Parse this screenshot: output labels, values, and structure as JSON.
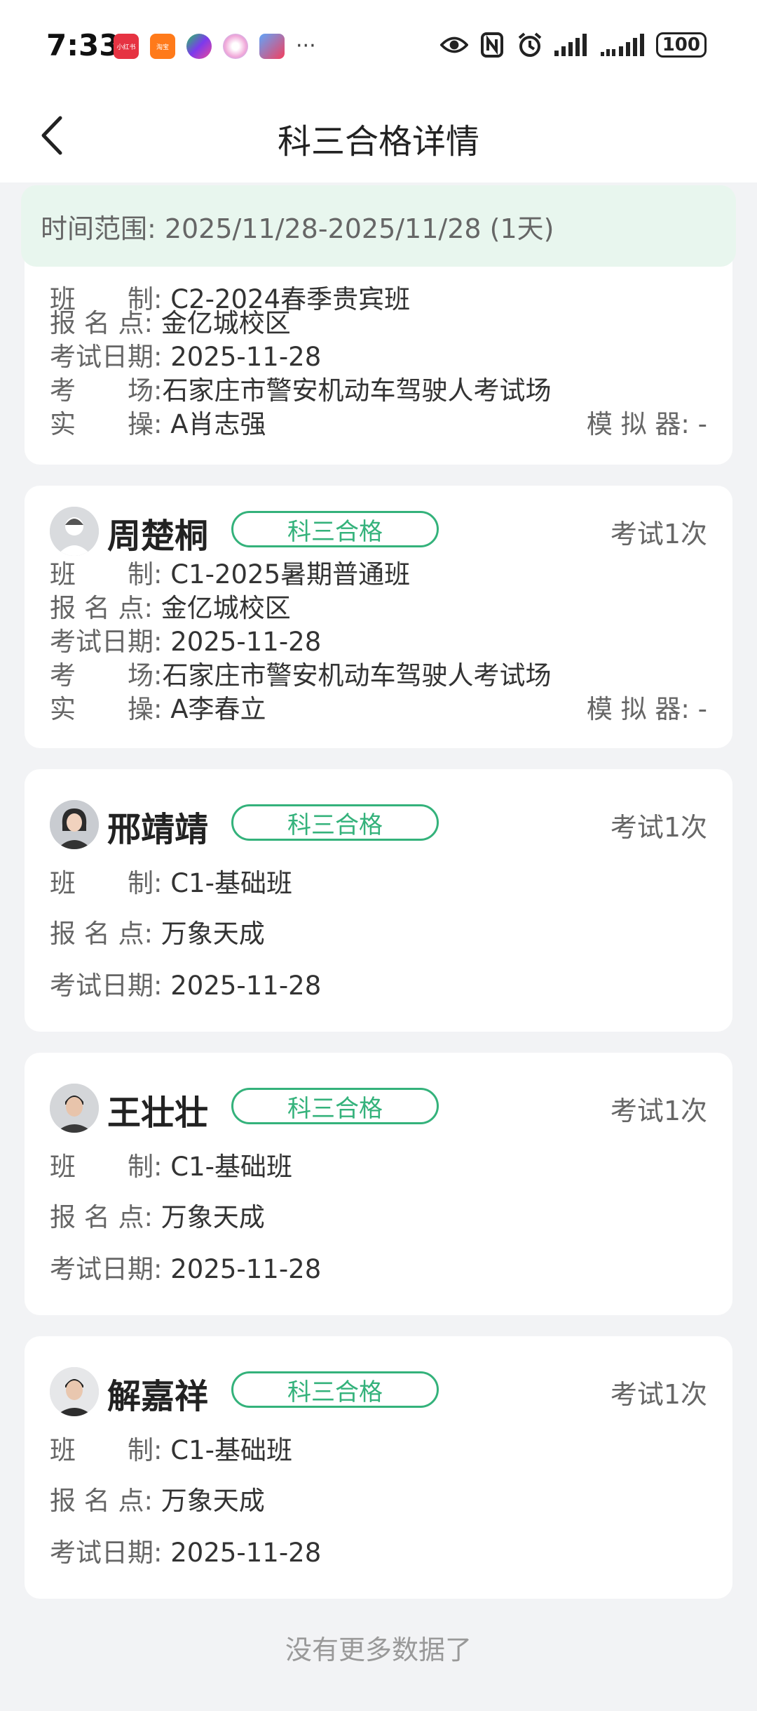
{
  "status_bar": {
    "time": "7:33",
    "app_icons": [
      {
        "name": "xiaohongshu-icon",
        "label": "小红书",
        "color": "#e63342"
      },
      {
        "name": "taobao-icon",
        "label": "淘宝",
        "color": "#ff7a1a"
      },
      {
        "name": "game-icon",
        "label": "",
        "color": "#7c3aed"
      },
      {
        "name": "assistant-icon",
        "label": "",
        "color": "#f0a6d8"
      },
      {
        "name": "browser-icon",
        "label": "",
        "color": "#3b82f6"
      }
    ],
    "more": "···",
    "battery": "100"
  },
  "header": {
    "title": "科三合格详情"
  },
  "range": {
    "label": "时间范围:",
    "value": "2025/11/28-2025/11/28 (1天)"
  },
  "labels": {
    "class": "班　　制:",
    "site": "报 名 点:",
    "date": "考试日期:",
    "venue": "考　　场:",
    "coach": "实　　操:",
    "simulator": "模 拟 器:"
  },
  "cards": [
    {
      "partial": true,
      "class": "C2-2024春季贵宾班",
      "site": "金亿城校区",
      "date": "2025-11-28",
      "venue": "石家庄市警安机动车驾驶人考试场",
      "coach": "A肖志强",
      "simulator": "-"
    },
    {
      "name": "周楚桐",
      "tag": "科三合格",
      "count": "考试1次",
      "class": "C1-2025暑期普通班",
      "site": "金亿城校区",
      "date": "2025-11-28",
      "venue": "石家庄市警安机动车驾驶人考试场",
      "coach": "A李春立",
      "simulator": "-"
    },
    {
      "name": "邢靖靖",
      "tag": "科三合格",
      "count": "考试1次",
      "class": "C1-基础班",
      "site": "万象天成",
      "date": "2025-11-28"
    },
    {
      "name": "王壮壮",
      "tag": "科三合格",
      "count": "考试1次",
      "class": "C1-基础班",
      "site": "万象天成",
      "date": "2025-11-28"
    },
    {
      "name": "解嘉祥",
      "tag": "科三合格",
      "count": "考试1次",
      "class": "C1-基础班",
      "site": "万象天成",
      "date": "2025-11-28"
    }
  ],
  "footer": "没有更多数据了",
  "colors": {
    "accent": "#34b27b",
    "range_bg": "#e8f6ee",
    "page_bg": "#f2f3f5"
  }
}
